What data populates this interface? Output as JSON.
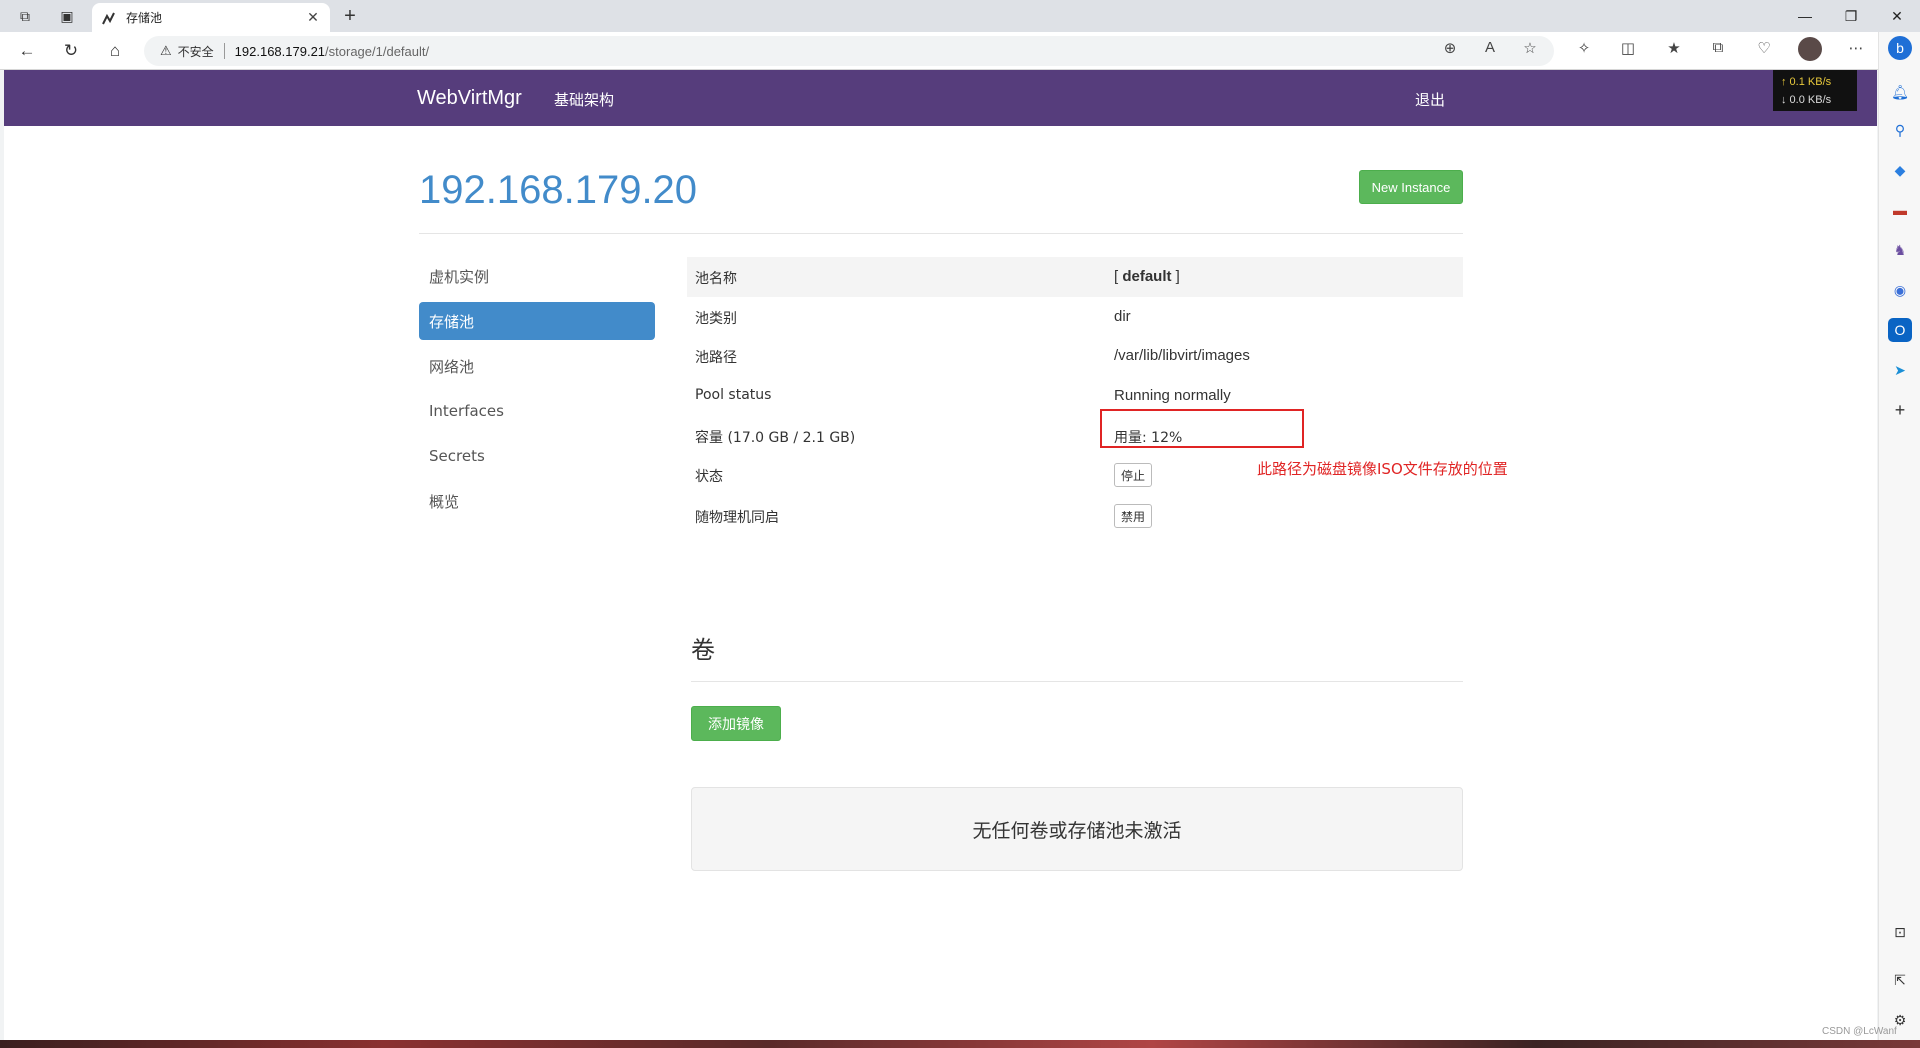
{
  "browser": {
    "tab_title": "存储池",
    "address_insecure": "不安全",
    "address_host": "192.168.179.21",
    "address_path": "/storage/1/default/"
  },
  "app": {
    "brand": "WebVirtMgr",
    "nav_infrastructure": "基础架构",
    "nav_logout": "退出"
  },
  "speed": {
    "up": "↑ 0.1 KB/s",
    "down": "↓ 0.0 KB/s"
  },
  "page": {
    "title": "192.168.179.20",
    "new_instance": "New Instance"
  },
  "sidebar": {
    "items": [
      {
        "label": "虚机实例"
      },
      {
        "label": "存储池"
      },
      {
        "label": "网络池"
      },
      {
        "label": "Interfaces"
      },
      {
        "label": "Secrets"
      },
      {
        "label": "概览"
      }
    ]
  },
  "pool": {
    "name_label": "池名称",
    "name_value": "default",
    "type_label": "池类别",
    "type_value": "dir",
    "path_label": "池路径",
    "path_value": "/var/lib/libvirt/images",
    "status_label": "Pool status",
    "status_value": "Running normally",
    "capacity_label": "容量 (17.0 GB / 2.1 GB)",
    "usage_value": "用量: 12%",
    "state_label": "状态",
    "stop_button": "停止",
    "autostart_label": "随物理机同启",
    "disable_button": "禁用"
  },
  "annotation": "此路径为磁盘镜像ISO文件存放的位置",
  "volumes": {
    "title": "卷",
    "add_button": "添加镜像",
    "empty_message": "无任何卷或存储池未激活"
  },
  "watermark": "CSDN @LcWanf"
}
